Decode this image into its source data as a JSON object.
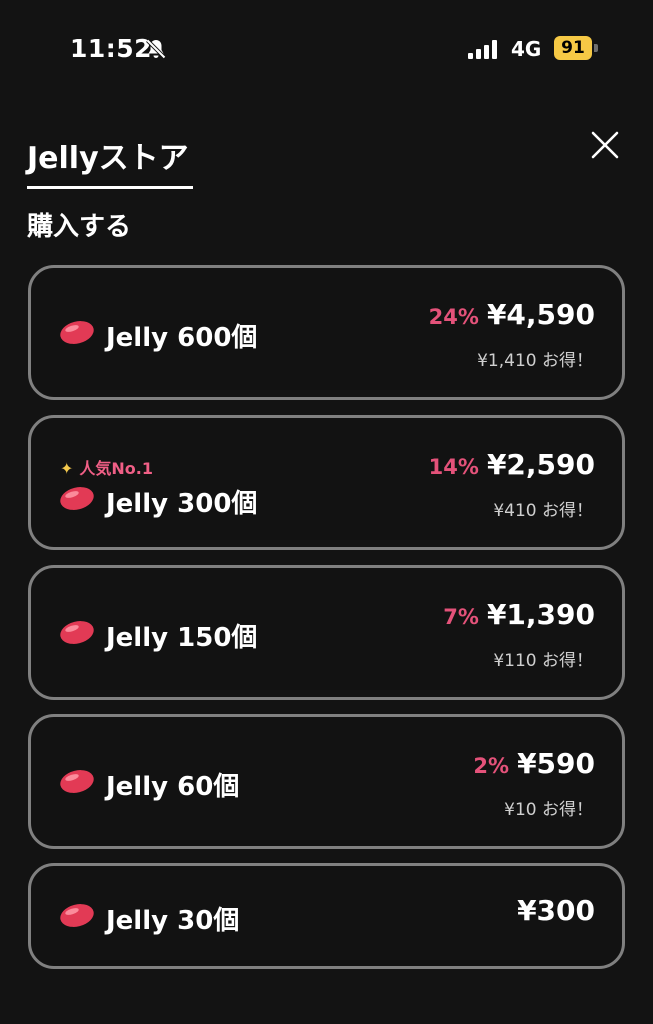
{
  "status_bar": {
    "time": "11:52",
    "network": "4G",
    "battery": "91"
  },
  "header": {
    "tab_title": "Jellyストア",
    "section_title": "購入する"
  },
  "colors": {
    "background": "#131313",
    "card_border": "#808080",
    "discount": "#e4527a",
    "badge": "#f05f86",
    "battery": "#f6c945"
  },
  "products": [
    {
      "name": "Jelly 600個",
      "discount": "24%",
      "price": "¥4,590",
      "savings": "¥1,410 お得！",
      "badge": ""
    },
    {
      "name": "Jelly 300個",
      "discount": "14%",
      "price": "¥2,590",
      "savings": "¥410 お得！",
      "badge": "人気No.1"
    },
    {
      "name": "Jelly 150個",
      "discount": "7%",
      "price": "¥1,390",
      "savings": "¥110 お得！",
      "badge": ""
    },
    {
      "name": "Jelly 60個",
      "discount": "2%",
      "price": "¥590",
      "savings": "¥10 お得！",
      "badge": ""
    },
    {
      "name": "Jelly 30個",
      "discount": "",
      "price": "¥300",
      "savings": "",
      "badge": ""
    }
  ]
}
